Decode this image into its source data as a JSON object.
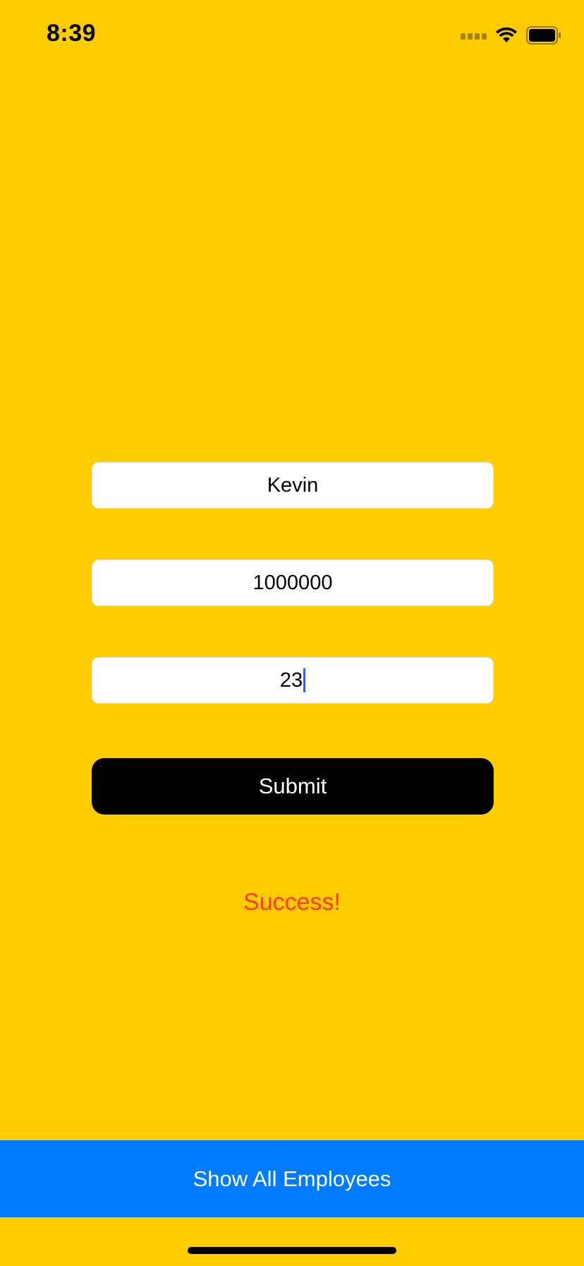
{
  "status_bar": {
    "time": "8:39"
  },
  "form": {
    "name_value": "Kevin",
    "salary_value": "1000000",
    "age_value": "23"
  },
  "submit_label": "Submit",
  "status_message": "Success!",
  "show_all_label": "Show All Employees",
  "colors": {
    "background": "#FFCC00",
    "submit_bg": "#000000",
    "success_text": "#FF3B30",
    "bottom_button_bg": "#007AFF",
    "caret": "#3B5BF0"
  }
}
